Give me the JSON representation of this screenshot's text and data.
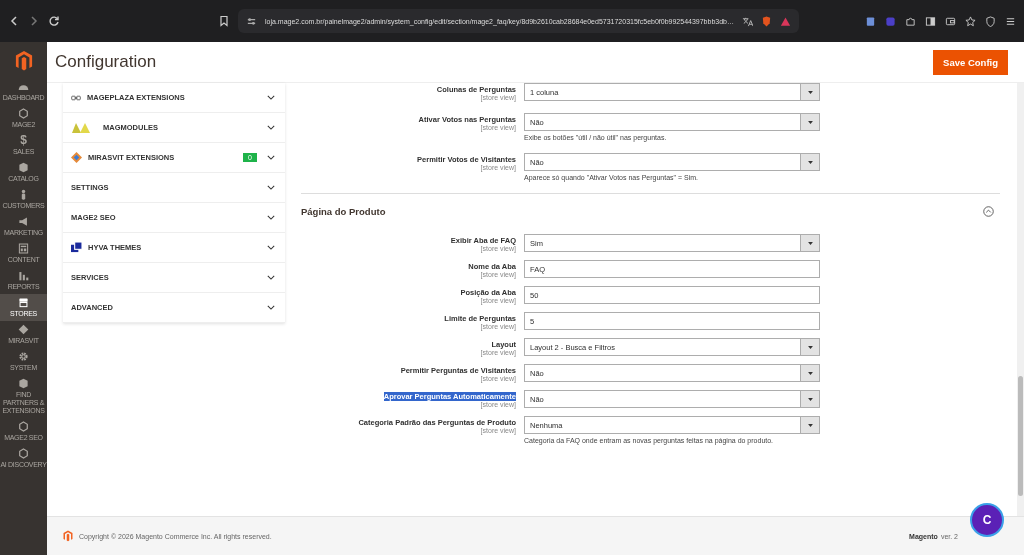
{
  "browser": {
    "url": "loja.mage2.com.br/painelmage2/admin/system_config/edit/section/mage2_faq/key/8d9b2610cab28684e0ed5731720315fc5eb0f0b992544397bbb3db…"
  },
  "nav": [
    {
      "label": "DASHBOARD",
      "selected": false
    },
    {
      "label": "MAGE2",
      "selected": false
    },
    {
      "label": "SALES",
      "glyph": "$",
      "selected": false
    },
    {
      "label": "CATALOG",
      "selected": false
    },
    {
      "label": "CUSTOMERS",
      "selected": false
    },
    {
      "label": "MARKETING",
      "selected": false
    },
    {
      "label": "CONTENT",
      "selected": false
    },
    {
      "label": "REPORTS",
      "selected": false
    },
    {
      "label": "STORES",
      "selected": true
    },
    {
      "label": "MIRASVIT",
      "selected": false
    },
    {
      "label": "SYSTEM",
      "selected": false
    },
    {
      "label": "FIND PARTNERS & EXTENSIONS",
      "selected": false
    },
    {
      "label": "MAGE2 SEO",
      "selected": false
    },
    {
      "label": "AI DISCOVERY",
      "selected": false
    }
  ],
  "page": {
    "title": "Configuration",
    "save_button": "Save Config"
  },
  "config_tabs": [
    {
      "label": "MAGEPLAZA EXTENSIONS",
      "kind": "chain",
      "expanded": false
    },
    {
      "label": "MAGMODULES",
      "kind": "wings",
      "expanded": false
    },
    {
      "label": "MIRASVIT EXTENSIONS",
      "kind": "diamond",
      "badge": "0",
      "expanded": false
    },
    {
      "label": "SETTINGS",
      "kind": "plain",
      "expanded": false
    },
    {
      "label": "MAGE2 SEO",
      "kind": "plain",
      "expanded": false
    },
    {
      "label": "HYVA THEMES",
      "kind": "squares",
      "expanded": false
    },
    {
      "label": "SERVICES",
      "kind": "plain",
      "expanded": false
    },
    {
      "label": "ADVANCED",
      "kind": "plain",
      "expanded": false
    }
  ],
  "sections": [
    {
      "fields": [
        {
          "label": "Colunas de Perguntas",
          "scope": "[store view]",
          "kind": "select",
          "value": "1 coluna"
        },
        {
          "label": "Ativar Votos nas Perguntas",
          "scope": "[store view]",
          "kind": "select",
          "value": "Não",
          "note": "Exibe os botões \"útil / não útil\" nas perguntas."
        },
        {
          "label": "Permitir Votos de Visitantes",
          "scope": "[store view]",
          "kind": "select",
          "value": "Não",
          "note": "Aparece só quando \"Ativar Votos nas Perguntas\" = Sim."
        }
      ]
    },
    {
      "title": "Página do Produto",
      "expanded": true,
      "fields": [
        {
          "label": "Exibir Aba de FAQ",
          "scope": "[store view]",
          "kind": "select",
          "value": "Sim"
        },
        {
          "label": "Nome da Aba",
          "scope": "[store view]",
          "kind": "text",
          "value": "FAQ"
        },
        {
          "label": "Posição da Aba",
          "scope": "[store view]",
          "kind": "text",
          "value": "50"
        },
        {
          "label": "Limite de Perguntas",
          "scope": "[store view]",
          "kind": "text",
          "value": "5"
        },
        {
          "label": "Layout",
          "scope": "[store view]",
          "kind": "select",
          "value": "Layout 2 - Busca e Filtros"
        },
        {
          "label": "Permitir Perguntas de Visitantes",
          "scope": "[store view]",
          "kind": "select",
          "value": "Não"
        },
        {
          "label": "Aprovar Perguntas Automaticamente",
          "scope": "[store view]",
          "kind": "select",
          "value": "Não",
          "text_selected": true
        },
        {
          "label": "Categoria Padrão das Perguntas de Produto",
          "scope": "[store view]",
          "kind": "select",
          "value": "Nenhuma",
          "note": "Categoria da FAQ onde entram as novas perguntas feitas na página do produto."
        }
      ]
    }
  ],
  "footer": {
    "copyright": "Copyright © 2026 Magento Commerce Inc. All rights reserved.",
    "brand": "Magento",
    "version": "ver. 2"
  },
  "chat_button": "C"
}
